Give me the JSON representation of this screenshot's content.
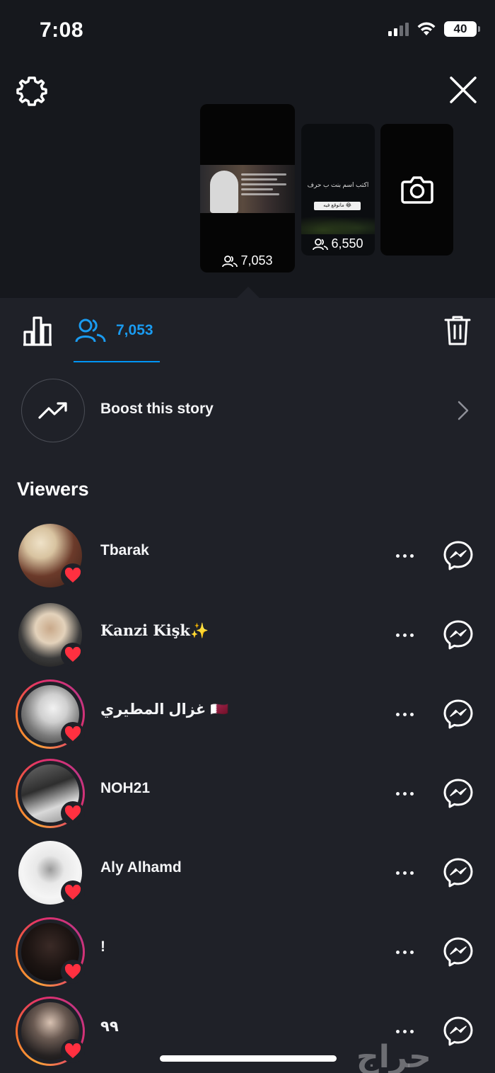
{
  "status_bar": {
    "time": "7:08",
    "battery": "40"
  },
  "stories": [
    {
      "count": "7,053",
      "selected": true
    },
    {
      "count": "6,550",
      "caption": "اكتب اسم بنت ب حرف",
      "chip": "ماتوقع فيه 😂"
    },
    {
      "type": "camera"
    }
  ],
  "tabs": {
    "viewers_count": "7,053"
  },
  "boost": {
    "label": "Boost this story"
  },
  "viewers_heading": "Viewers",
  "viewers": [
    {
      "name": "Tbarak",
      "ring": false,
      "liked": true
    },
    {
      "name": "Kanzi Kişk✨",
      "ring": false,
      "liked": true
    },
    {
      "name": "غزال المطيري 🇶🇦",
      "ring": true,
      "liked": true
    },
    {
      "name": "NOH21",
      "ring": true,
      "liked": true
    },
    {
      "name": "Aly Alhamd",
      "ring": false,
      "liked": true
    },
    {
      "name": "!",
      "ring": true,
      "liked": true
    },
    {
      "name": "٩٩",
      "ring": true,
      "liked": true
    }
  ],
  "watermark": "حراج",
  "colors": {
    "accent": "#0095f6",
    "heart": "#ff3040",
    "background": "#1f2128"
  }
}
